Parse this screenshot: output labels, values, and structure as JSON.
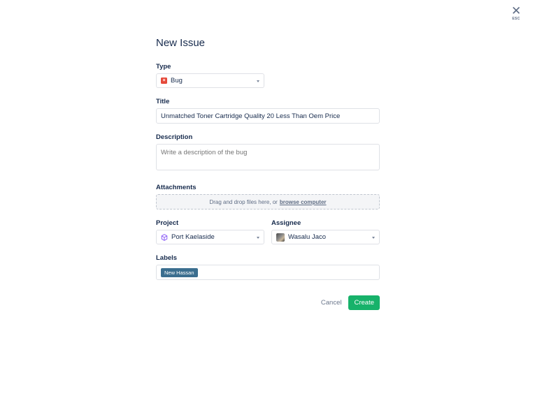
{
  "close": {
    "icon": "close-icon",
    "label": "ESC"
  },
  "form": {
    "title": "New Issue",
    "type": {
      "label": "Type",
      "value": "Bug",
      "icon": "bug-icon"
    },
    "title_field": {
      "label": "Title",
      "value": "Unmatched Toner Cartridge Quality 20 Less Than Oem Price"
    },
    "description": {
      "label": "Description",
      "placeholder": "Write a description of the bug"
    },
    "attachments": {
      "label": "Attachments",
      "text": "Drag and drop files here, or",
      "link": "browse computer"
    },
    "project": {
      "label": "Project",
      "value": "Port Kaelaside",
      "icon": "cube-icon"
    },
    "assignee": {
      "label": "Assignee",
      "value": "Wasalu Jaco"
    },
    "labels": {
      "label": "Labels",
      "tags": [
        "New Hassan"
      ]
    },
    "actions": {
      "cancel": "Cancel",
      "create": "Create"
    }
  },
  "colors": {
    "accent": "#17b26a",
    "bug": "#e5493a",
    "tag": "#3b6e8f",
    "project_icon": "#8b5cf6"
  }
}
